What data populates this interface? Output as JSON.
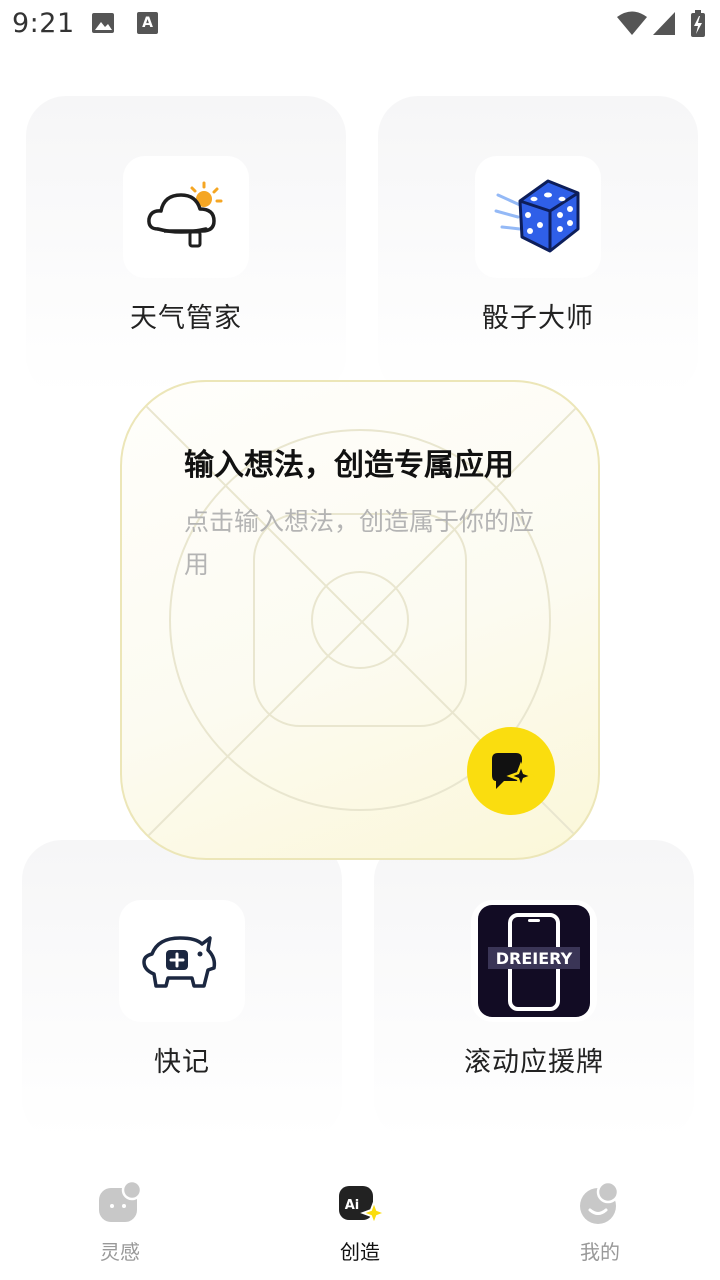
{
  "status_bar": {
    "time": "9:21",
    "icons": [
      "image-icon",
      "a-notification-icon",
      "wifi-icon",
      "cell-signal-icon",
      "battery-icon"
    ]
  },
  "apps": [
    {
      "label": "天气管家",
      "icon": "weather-cloud-sun-icon"
    },
    {
      "label": "骰子大师",
      "icon": "blue-dice-icon"
    },
    {
      "label": "快记",
      "icon": "piggy-bank-icon"
    },
    {
      "label": "滚动应援牌",
      "icon": "phone-banner-icon",
      "icon_text": "DREIERY"
    }
  ],
  "create_panel": {
    "title": "输入想法，创造专属应用",
    "hint": "点击输入想法，创造属于你的应用",
    "button_icon": "sparkle-create-icon",
    "accent": "#fadd0f"
  },
  "bottom_nav": {
    "items": [
      {
        "label": "灵感",
        "icon": "inspiration-chat-icon",
        "active": false
      },
      {
        "label": "创造",
        "icon": "ai-create-icon",
        "active": true
      },
      {
        "label": "我的",
        "icon": "profile-face-icon",
        "active": false
      }
    ]
  }
}
